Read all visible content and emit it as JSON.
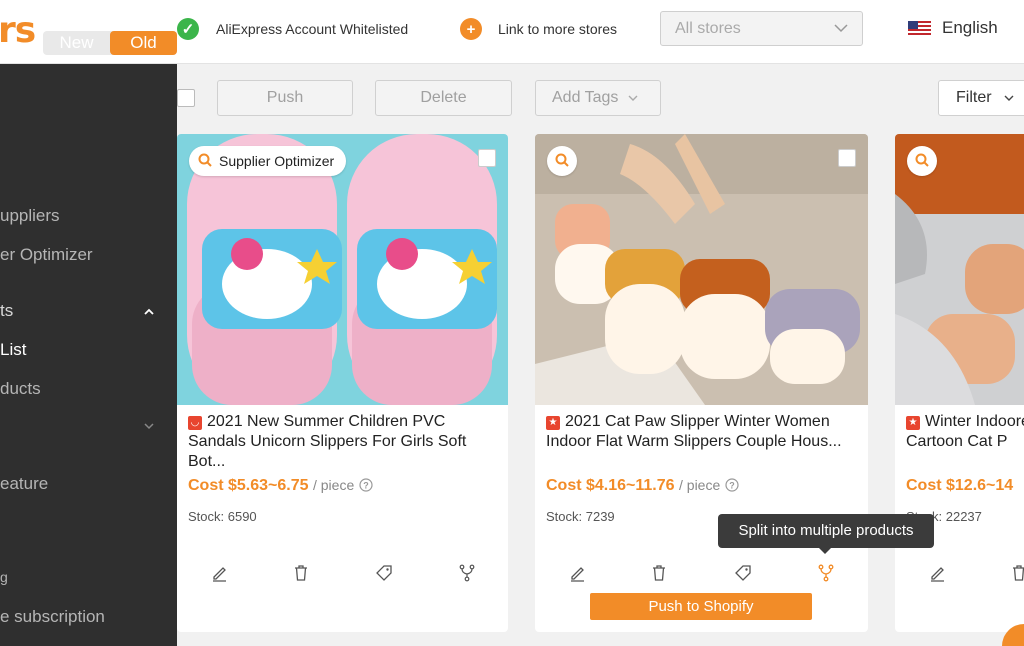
{
  "header": {
    "logo_text": "rs",
    "version_toggle": [
      "New",
      "Old"
    ],
    "whitelist_text": "AliExpress Account Whitelisted",
    "link_stores_text": "Link to more stores",
    "store_select_placeholder": "All stores",
    "language": "English"
  },
  "sidebar": {
    "items": [
      {
        "label": "uppliers"
      },
      {
        "label": "er Optimizer"
      },
      {
        "label": "ts"
      },
      {
        "label": " List"
      },
      {
        "label": "ducts"
      },
      {
        "label": "eature"
      },
      {
        "label": "g"
      },
      {
        "label": "e subscription"
      }
    ]
  },
  "toolbar": {
    "push_label": "Push",
    "delete_label": "Delete",
    "add_tags_label": "Add Tags",
    "filter_label": "Filter"
  },
  "products": [
    {
      "badge": "Supplier Optimizer",
      "title": "2021 New Summer Children PVC Sandals Unicorn Slippers For Girls Soft Bot...",
      "cost": "Cost $5.63~6.75",
      "unit": "/ piece",
      "stock": "Stock: 6590"
    },
    {
      "badge": "",
      "title": "2021 Cat Paw Slipper Winter Women Indoor Flat Warm Slippers Couple Hous...",
      "cost": "Cost $4.16~11.76",
      "unit": "/ piece",
      "stock": "Stock: 7239",
      "push_label": "Push to Shopify"
    },
    {
      "badge": "",
      "title": "Winter Indoore Cartoon Cat P",
      "cost": "Cost $12.6~14",
      "unit": "",
      "stock": "Stock: 22237"
    }
  ],
  "tooltip": "Split into multiple products",
  "colors": {
    "accent": "#f28c28",
    "sidebar_bg": "#2f2f2f",
    "check_green": "#3bb54a",
    "store_red": "#e8452f"
  }
}
